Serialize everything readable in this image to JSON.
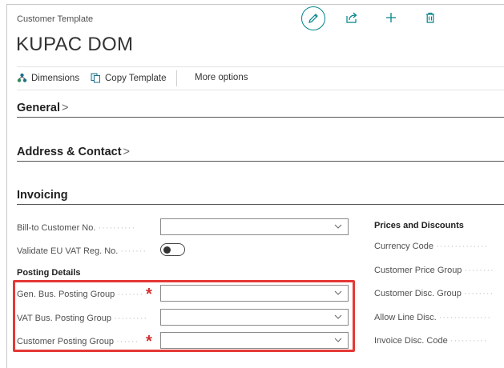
{
  "header": {
    "caption": "Customer Template",
    "title": "KUPAC DOM"
  },
  "actions": {
    "dimensions": "Dimensions",
    "copy_template": "Copy Template",
    "more_options": "More options"
  },
  "sections": {
    "general": "General",
    "address_contact": "Address & Contact",
    "invoicing": "Invoicing"
  },
  "invoicing": {
    "bill_to_customer_no": {
      "label": "Bill-to Customer No.",
      "value": ""
    },
    "validate_eu_vat": {
      "label": "Validate EU VAT Reg. No.",
      "checked": false
    },
    "posting_details_header": "Posting Details",
    "gen_bus_posting_group": {
      "label": "Gen. Bus. Posting Group",
      "value": "",
      "required": true
    },
    "vat_bus_posting_group": {
      "label": "VAT Bus. Posting Group",
      "value": "",
      "required": false
    },
    "customer_posting_group": {
      "label": "Customer Posting Group",
      "value": "",
      "required": true
    },
    "required_mark": "*"
  },
  "prices_discounts": {
    "header": "Prices and Discounts",
    "fields": [
      {
        "label": "Currency Code"
      },
      {
        "label": "Customer Price Group"
      },
      {
        "label": "Customer Disc. Group"
      },
      {
        "label": "Allow Line Disc."
      },
      {
        "label": "Invoice Disc. Code"
      }
    ]
  },
  "icons": {
    "edit": "pencil-icon",
    "share": "share-icon",
    "new": "plus-icon",
    "delete": "trash-icon",
    "dimensions": "dimensions-icon",
    "copy": "copy-icon",
    "dropdown": "chevron-down-icon",
    "section_chevron": ">"
  },
  "colors": {
    "accent": "#008489",
    "required": "#d32f2f",
    "highlight": "#e53935"
  }
}
